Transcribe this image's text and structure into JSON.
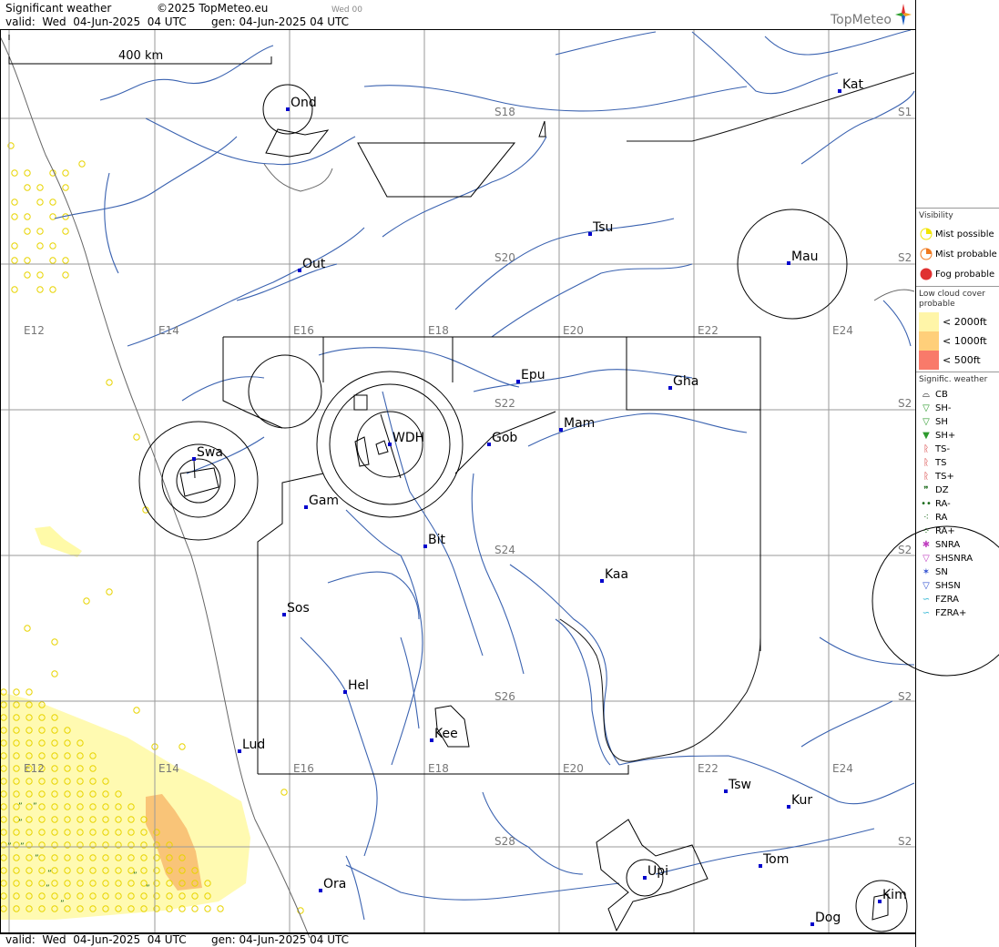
{
  "header": {
    "title": "Significant weather",
    "copyright": "©2025 TopMeteo.eu",
    "run": "Wed 00",
    "valid": "valid:  Wed  04-Jun-2025  04 UTC",
    "gen": "gen: 04-Jun-2025 04 UTC",
    "logo": "TopMeteo"
  },
  "footer": {
    "valid": "valid:  Wed  04-Jun-2025  04 UTC",
    "gen": "gen: 04-Jun-2025 04 UTC"
  },
  "scale_label": "400 km",
  "lat_labels": [
    "S18",
    "S20",
    "S22",
    "S24",
    "S26",
    "S28"
  ],
  "lon_labels": [
    "E12",
    "E14",
    "E16",
    "E18",
    "E20",
    "E22",
    "E24"
  ],
  "edge_lat_labels": [
    "S1",
    "S2",
    "S2",
    "S2",
    "S2",
    "S2"
  ],
  "stations": [
    {
      "code": "Ond"
    },
    {
      "code": "Kat"
    },
    {
      "code": "Tsu"
    },
    {
      "code": "Mau"
    },
    {
      "code": "Out"
    },
    {
      "code": "Epu"
    },
    {
      "code": "Gha"
    },
    {
      "code": "Mam"
    },
    {
      "code": "WDH"
    },
    {
      "code": "Gob"
    },
    {
      "code": "Swa"
    },
    {
      "code": "Gam"
    },
    {
      "code": "Bit"
    },
    {
      "code": "Kaa"
    },
    {
      "code": "Sos"
    },
    {
      "code": "Hel"
    },
    {
      "code": "Kee"
    },
    {
      "code": "Lud"
    },
    {
      "code": "Tsw"
    },
    {
      "code": "Kur"
    },
    {
      "code": "Tom"
    },
    {
      "code": "Upi"
    },
    {
      "code": "Ora"
    },
    {
      "code": "Kim"
    },
    {
      "code": "Dog"
    }
  ],
  "legend": {
    "visibility": {
      "title": "Visibility",
      "items": [
        {
          "label": "Mist possible",
          "color": "#f2e600"
        },
        {
          "label": "Mist probable",
          "color": "#f07a20"
        },
        {
          "label": "Fog probable",
          "color": "#e03030"
        }
      ]
    },
    "low_cloud": {
      "title": "Low cloud cover probable",
      "items": [
        {
          "label": "< 2000ft",
          "color": "#fff5a8"
        },
        {
          "label": "< 1000ft",
          "color": "#ffcf7a"
        },
        {
          "label": "<   500ft",
          "color": "#f97a6a"
        }
      ]
    },
    "weather": {
      "title": "Signific. weather",
      "items": [
        {
          "label": "CB",
          "icon": "cb-icon",
          "color": "#000000"
        },
        {
          "label": "SH-",
          "icon": "shower-light-icon",
          "color": "#2e9a2e"
        },
        {
          "label": "SH",
          "icon": "shower-icon",
          "color": "#2e9a2e"
        },
        {
          "label": "SH+",
          "icon": "shower-heavy-icon",
          "color": "#2e9a2e"
        },
        {
          "label": "TS-",
          "icon": "thunder-light-icon",
          "color": "#d02020"
        },
        {
          "label": "TS",
          "icon": "thunder-icon",
          "color": "#d02020"
        },
        {
          "label": "TS+",
          "icon": "thunder-heavy-icon",
          "color": "#d02020"
        },
        {
          "label": "DZ",
          "icon": "drizzle-icon",
          "color": "#1a6a1a"
        },
        {
          "label": "RA-",
          "icon": "rain-light-icon",
          "color": "#1a6a1a"
        },
        {
          "label": "RA",
          "icon": "rain-icon",
          "color": "#1a6a1a"
        },
        {
          "label": "RA+",
          "icon": "rain-heavy-icon",
          "color": "#1a6a1a"
        },
        {
          "label": "SNRA",
          "icon": "snow-rain-icon",
          "color": "#c040c0"
        },
        {
          "label": "SHSNRA",
          "icon": "snow-rain-shower-icon",
          "color": "#c040c0"
        },
        {
          "label": "SN",
          "icon": "snow-icon",
          "color": "#3050d0"
        },
        {
          "label": "SHSN",
          "icon": "snow-shower-icon",
          "color": "#3050d0"
        },
        {
          "label": "FZRA",
          "icon": "freezing-rain-icon",
          "color": "#20b0d0"
        },
        {
          "label": "FZRA+",
          "icon": "freezing-rain-heavy-icon",
          "color": "#20b0d0"
        }
      ]
    }
  },
  "colors": {
    "river": "#3a62b0",
    "grid": "#9a9a9a",
    "border": "#000000",
    "station": "#0000cc",
    "mist": "#f2e600",
    "low_cloud": "#fff5a8",
    "low_cloud_mid": "#ffcf7a"
  }
}
